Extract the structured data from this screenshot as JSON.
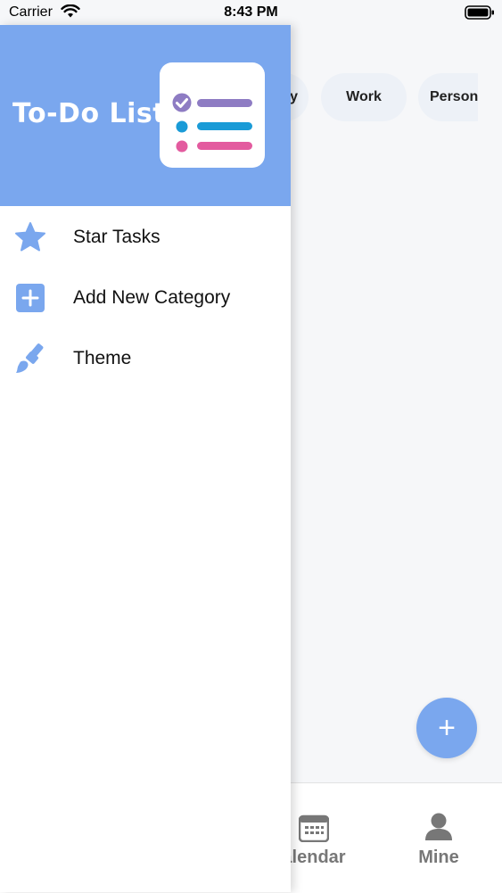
{
  "status_bar": {
    "carrier": "Carrier",
    "time": "8:43 PM"
  },
  "drawer": {
    "title": "To-Do List",
    "menu": [
      {
        "label": "Star Tasks",
        "icon": "star-icon"
      },
      {
        "label": "Add New Category",
        "icon": "add-box-icon"
      },
      {
        "label": "Theme",
        "icon": "paint-brush-icon"
      }
    ]
  },
  "background": {
    "chips": [
      {
        "label": "y"
      },
      {
        "label": "Work"
      },
      {
        "label": "Person"
      }
    ],
    "fab_label": "+",
    "tabs": [
      {
        "label": "alendar",
        "icon": "calendar-icon"
      },
      {
        "label": "Mine",
        "icon": "person-icon"
      }
    ]
  },
  "colors": {
    "accent": "#7aa7ee",
    "chip_bg": "#edf1f7",
    "check_purple": "#8e7cc3",
    "line_blue": "#1a9bd7",
    "line_pink": "#e35b9f"
  }
}
